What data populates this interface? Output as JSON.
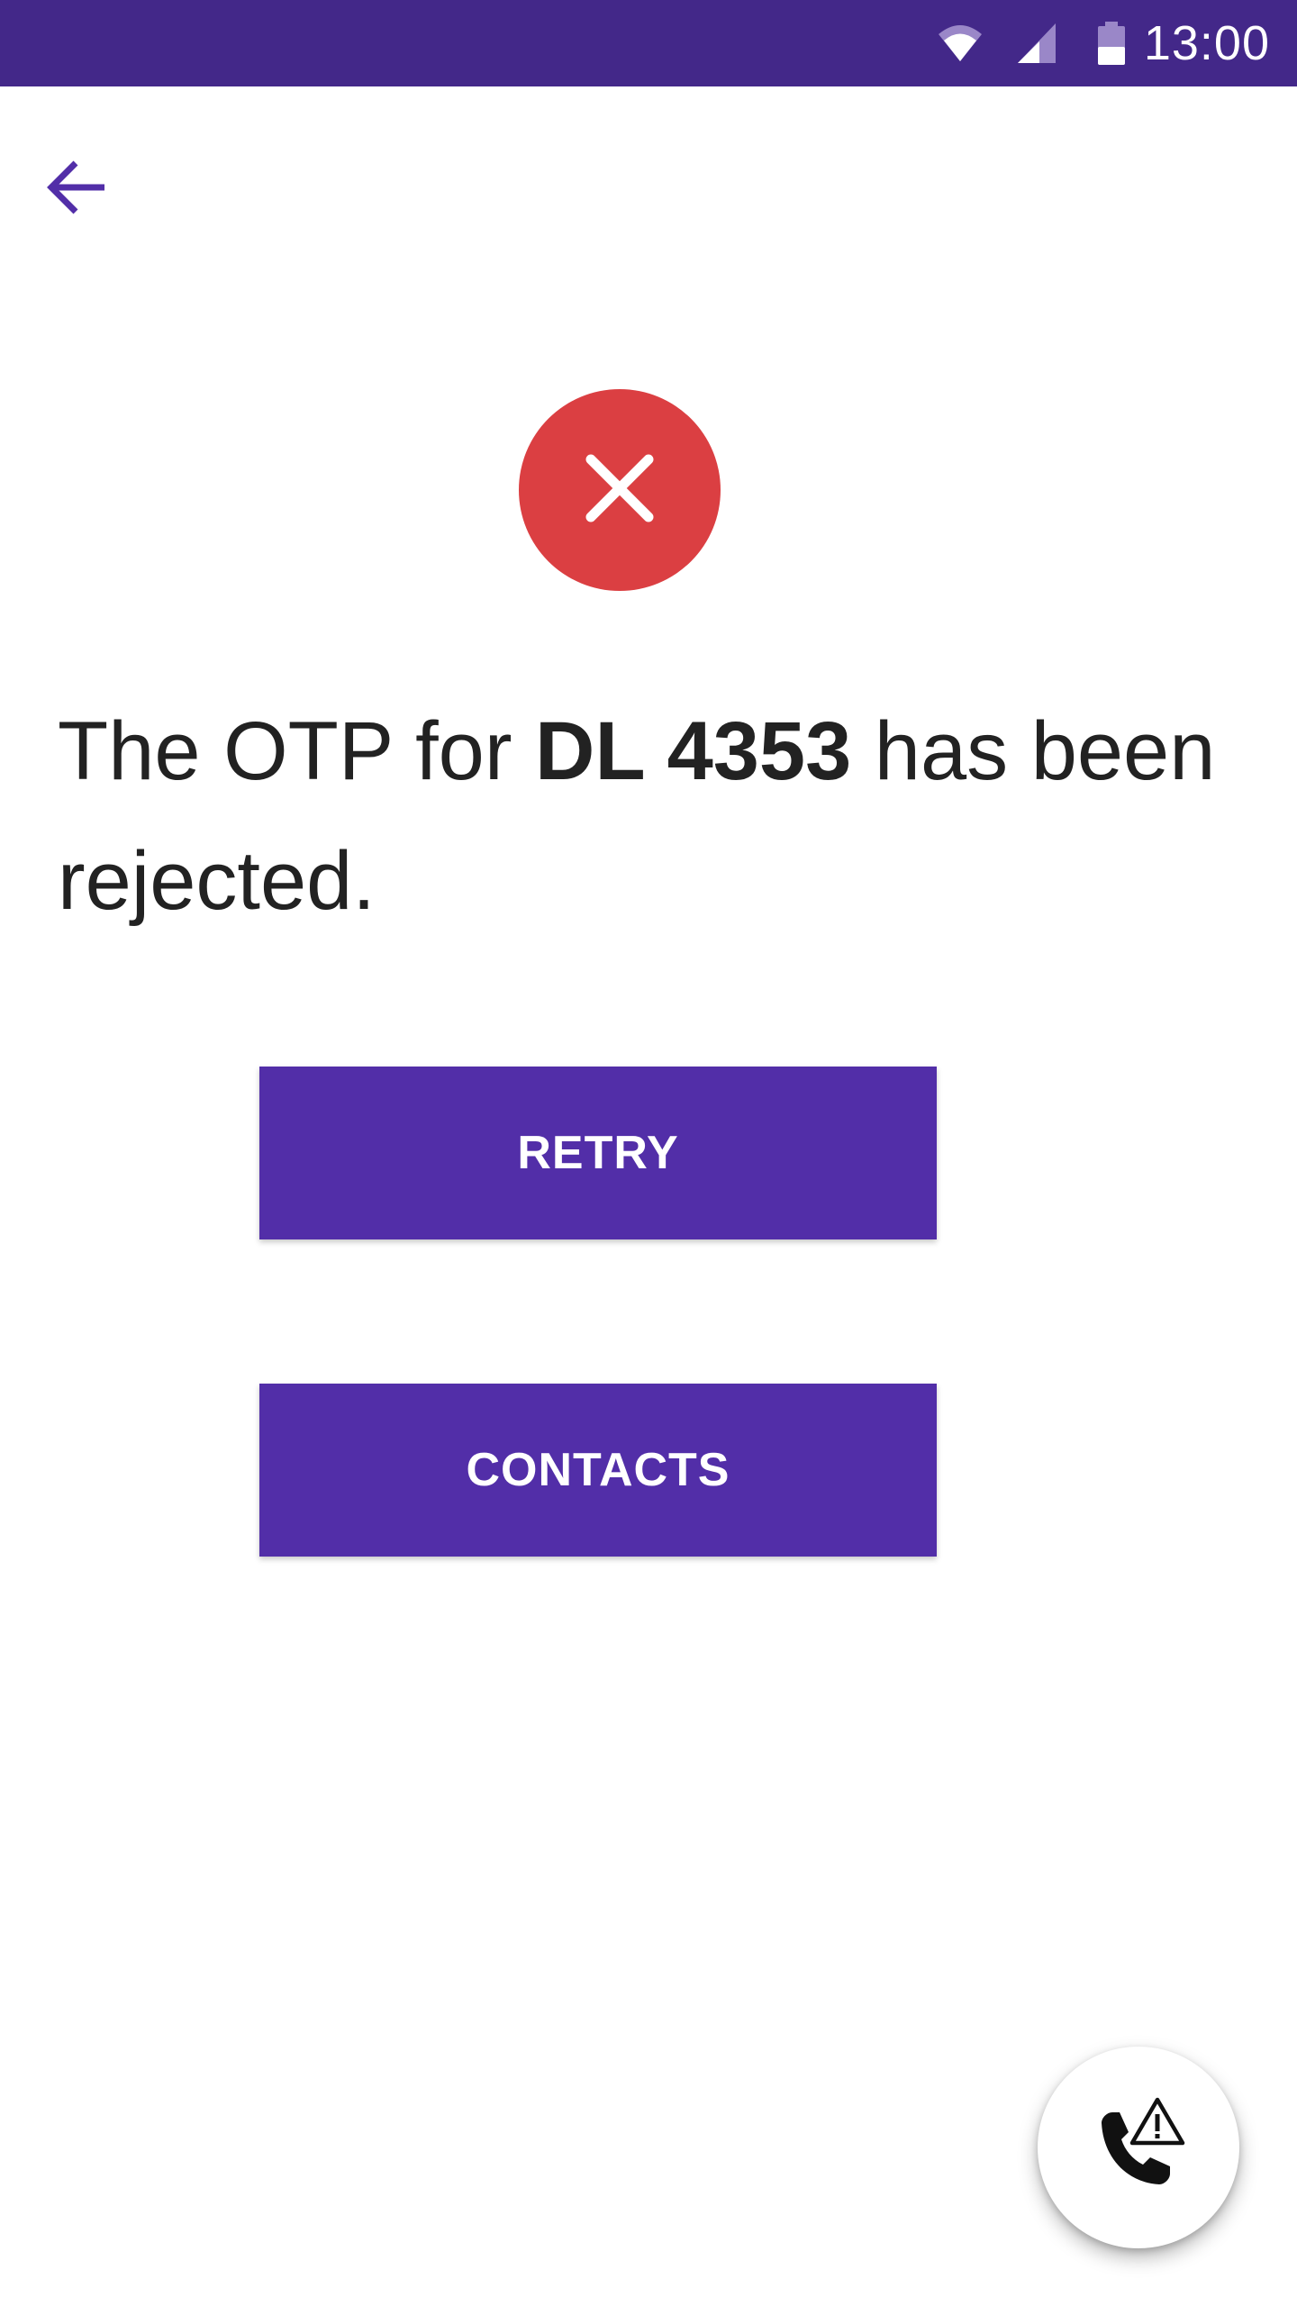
{
  "status_bar": {
    "time": "13:00",
    "background": "#432889",
    "icons": [
      "wifi-icon",
      "cell-signal-icon",
      "battery-icon"
    ]
  },
  "nav": {
    "back_icon": "arrow-back-icon",
    "accent": "#522ea8"
  },
  "status": {
    "icon": "close-icon",
    "color": "#db3f42"
  },
  "message": {
    "prefix": "The OTP for ",
    "highlight": "DL 4353",
    "suffix": " has been rejected."
  },
  "buttons": {
    "retry_label": "RETRY",
    "contacts_label": "CONTACTS",
    "color": "#522ea8"
  },
  "fab": {
    "icon": "phone-alert-icon"
  }
}
